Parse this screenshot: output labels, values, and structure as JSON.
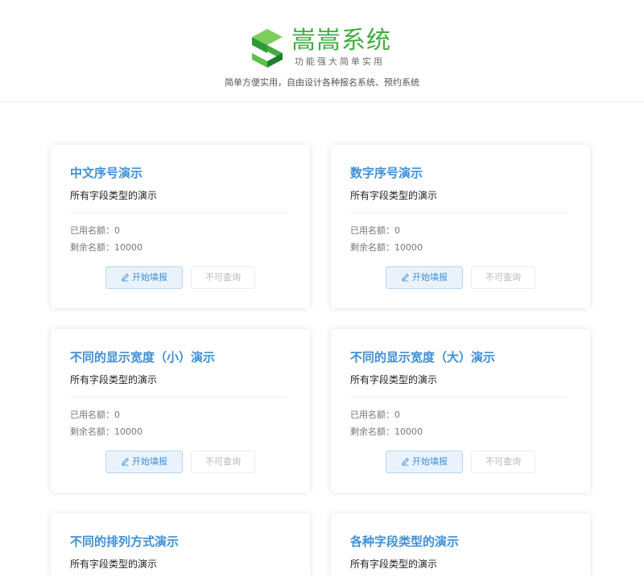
{
  "brand": {
    "name": "嵩嵩系统",
    "slogan": "功能强大简单实用",
    "subtitle": "简单方便实用，自由设计各种报名系统、预约系统",
    "colors": {
      "green_dark": "#1f7f2e",
      "green": "#3fae3f",
      "green_light": "#7ccf5a"
    }
  },
  "labels": {
    "fill_button": "开始填报",
    "query_button": "不可查询"
  },
  "cards": [
    {
      "title": "中文序号演示",
      "desc": "所有字段类型的演示",
      "used": "已用名额：0",
      "remaining": "剩余名额：10000"
    },
    {
      "title": "数字序号演示",
      "desc": "所有字段类型的演示",
      "used": "已用名额：0",
      "remaining": "剩余名额：10000"
    },
    {
      "title": "不同的显示宽度（小）演示",
      "desc": "所有字段类型的演示",
      "used": "已用名额：0",
      "remaining": "剩余名额：10000"
    },
    {
      "title": "不同的显示宽度（大）演示",
      "desc": "所有字段类型的演示",
      "used": "已用名额：0",
      "remaining": "剩余名额：10000"
    },
    {
      "title": "不同的排列方式演示",
      "desc": "所有字段类型的演示",
      "used": "",
      "remaining": ""
    },
    {
      "title": "各种字段类型的演示",
      "desc": "所有字段类型的演示",
      "used": "",
      "remaining": ""
    }
  ]
}
